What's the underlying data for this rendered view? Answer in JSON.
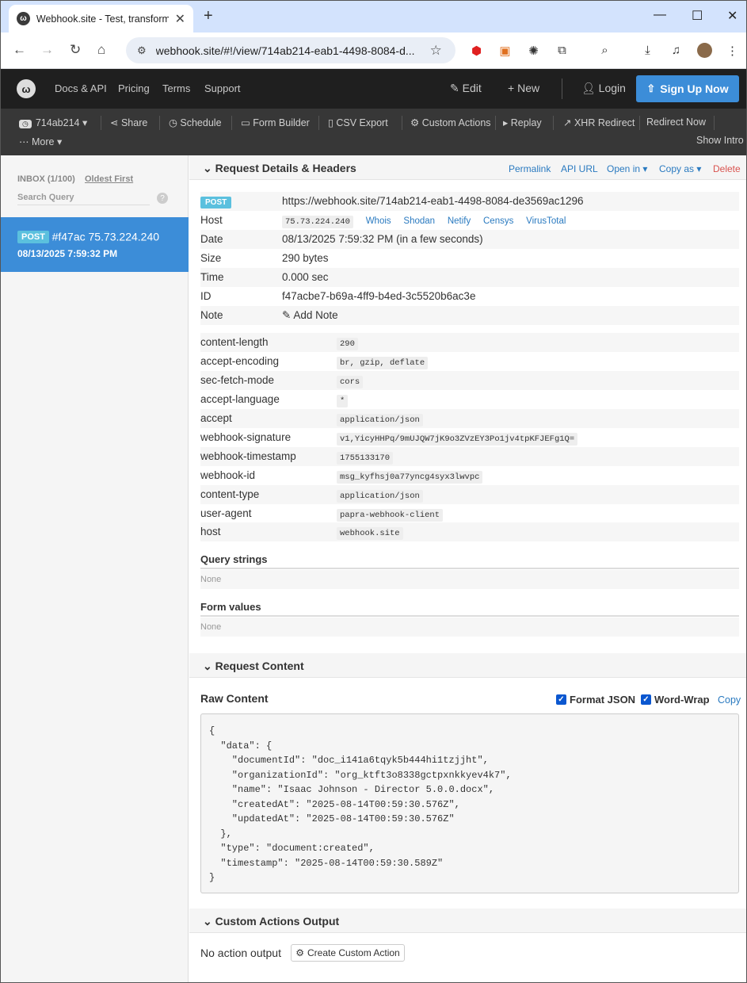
{
  "browser": {
    "tab_title": "Webhook.site - Test, transform an",
    "url": "webhook.site/#!/view/714ab214-eab1-4498-8084-d...",
    "tab_close": "✕",
    "newtab": "+"
  },
  "nav": {
    "links": [
      "Docs & API",
      "Pricing",
      "Terms",
      "Support"
    ],
    "edit": "Edit",
    "new": "New",
    "login": "Login",
    "signup": "Sign Up Now"
  },
  "actions": {
    "token": "714ab214",
    "share": "Share",
    "schedule": "Schedule",
    "form_builder": "Form Builder",
    "csv_export": "CSV Export",
    "custom_actions": "Custom Actions",
    "replay": "Replay",
    "xhr_redirect": "XHR Redirect",
    "redirect_now": "Redirect Now",
    "more": "More",
    "show_intro": "Show Intro"
  },
  "sidebar": {
    "inbox": "INBOX (1/100)",
    "sort": "Oldest First",
    "search_placeholder": "Search Query",
    "help": "?",
    "request": {
      "method": "POST",
      "label": "#f47ac 75.73.224.240",
      "date": "08/13/2025 7:59:32 PM"
    }
  },
  "details": {
    "title": "Request Details & Headers",
    "links": {
      "permalink": "Permalink",
      "api_url": "API URL",
      "open_in": "Open in",
      "copy_as": "Copy as",
      "delete": "Delete"
    },
    "method": "POST",
    "url": "https://webhook.site/714ab214-eab1-4498-8084-de3569ac1296",
    "host_label": "Host",
    "host_value": "75.73.224.240",
    "host_links": [
      "Whois",
      "Shodan",
      "Netify",
      "Censys",
      "VirusTotal"
    ],
    "date_label": "Date",
    "date_value": "08/13/2025 7:59:32 PM (in a few seconds)",
    "size_label": "Size",
    "size_value": "290 bytes",
    "time_label": "Time",
    "time_value": "0.000 sec",
    "id_label": "ID",
    "id_value": "f47acbe7-b69a-4ff9-b4ed-3c5520b6ac3e",
    "note_label": "Note",
    "note_value": "Add Note",
    "headers": [
      {
        "k": "content-length",
        "v": "290"
      },
      {
        "k": "accept-encoding",
        "v": "br, gzip, deflate"
      },
      {
        "k": "sec-fetch-mode",
        "v": "cors"
      },
      {
        "k": "accept-language",
        "v": "*"
      },
      {
        "k": "accept",
        "v": "application/json"
      },
      {
        "k": "webhook-signature",
        "v": "v1,YicyHHPq/9mUJQW7jK9o3ZVzEY3Po1jv4tpKFJEFg1Q="
      },
      {
        "k": "webhook-timestamp",
        "v": "1755133170"
      },
      {
        "k": "webhook-id",
        "v": "msg_kyfhsj0a77yncg4syx3lwvpc"
      },
      {
        "k": "content-type",
        "v": "application/json"
      },
      {
        "k": "user-agent",
        "v": "papra-webhook-client"
      },
      {
        "k": "host",
        "v": "webhook.site"
      }
    ],
    "query_title": "Query strings",
    "query_value": "None",
    "form_title": "Form values",
    "form_value": "None"
  },
  "content": {
    "title": "Request Content",
    "raw_title": "Raw Content",
    "format_json": "Format JSON",
    "word_wrap": "Word-Wrap",
    "copy": "Copy",
    "raw": "{\n  \"data\": {\n    \"documentId\": \"doc_i141a6tqyk5b444hi1tzjjht\",\n    \"organizationId\": \"org_ktft3o8338gctpxnkkyev4k7\",\n    \"name\": \"Isaac Johnson - Director 5.0.0.docx\",\n    \"createdAt\": \"2025-08-14T00:59:30.576Z\",\n    \"updatedAt\": \"2025-08-14T00:59:30.576Z\"\n  },\n  \"type\": \"document:created\",\n  \"timestamp\": \"2025-08-14T00:59:30.589Z\"\n}"
  },
  "custom_output": {
    "title": "Custom Actions Output",
    "no_output": "No action output",
    "create_button": "Create Custom Action"
  },
  "colors": {
    "accent": "#3c8dd8",
    "delete": "#d9534f",
    "post_badge": "#5bc0de"
  }
}
